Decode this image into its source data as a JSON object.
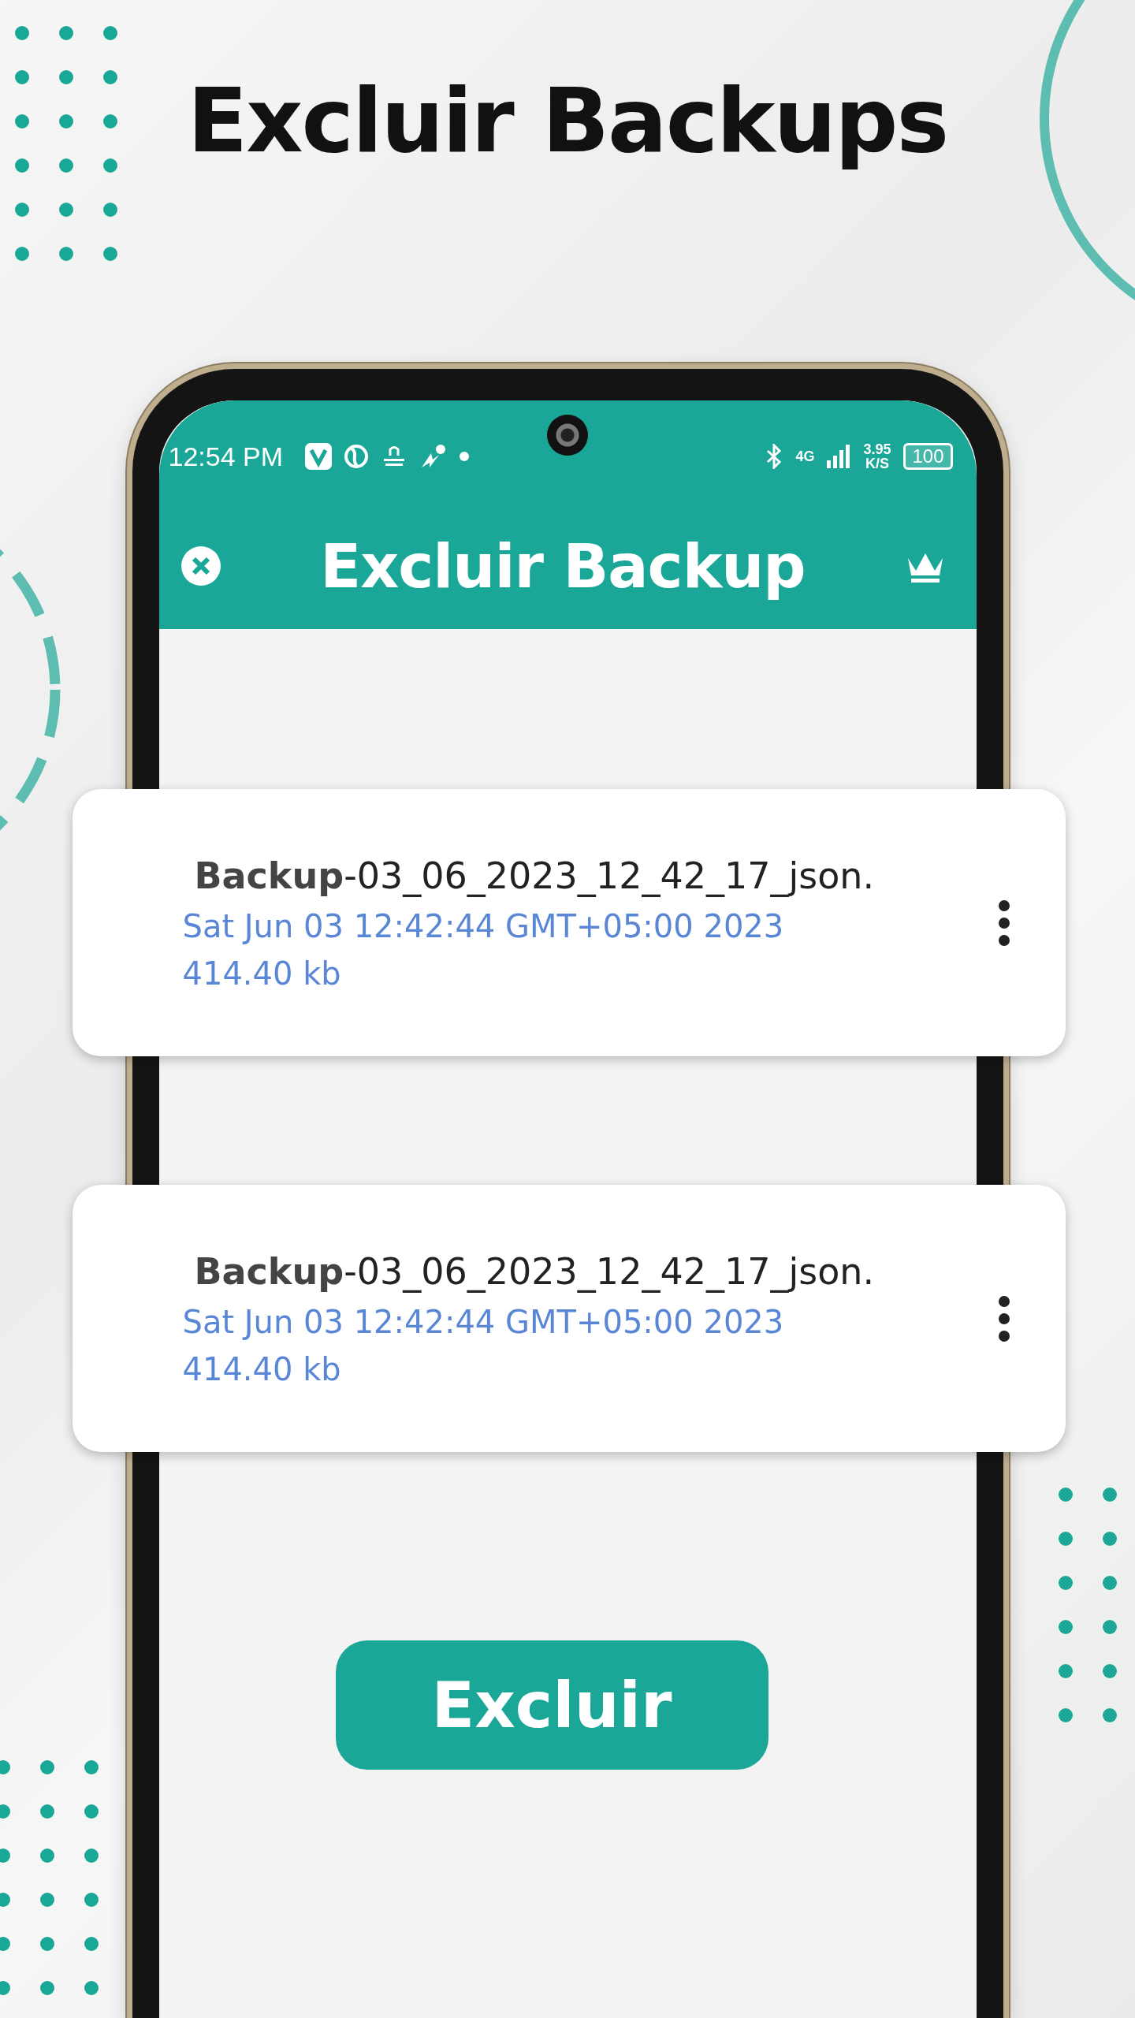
{
  "page_title": "Excluir Backups",
  "status_bar": {
    "time": "12:54 PM",
    "network": "4G",
    "speed": "3.95",
    "speed_unit": "K/S",
    "battery": "100"
  },
  "app_bar": {
    "title": "Excluir Backup"
  },
  "backups": [
    {
      "name": "**Backup**-03_06_2023_12_42_17_json.",
      "date": "Sat Jun 03 12:42:44 GMT+05:00 2023",
      "size": "414.40 kb"
    },
    {
      "name": "**Backup**-03_06_2023_12_42_17_json.",
      "date": "Sat Jun 03 12:42:44 GMT+05:00 2023",
      "size": "414.40 kb"
    }
  ],
  "delete_button": "Excluir"
}
